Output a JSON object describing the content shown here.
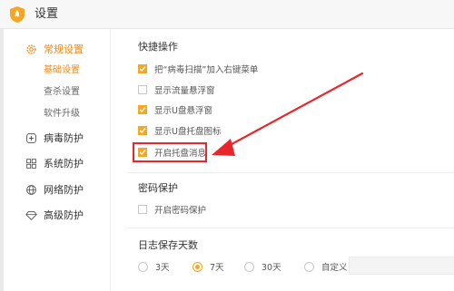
{
  "window": {
    "title": "设置"
  },
  "sidebar": {
    "groups": [
      {
        "label": "常规设置",
        "icon": "gear-icon",
        "active": true,
        "children": [
          {
            "label": "基础设置",
            "active": true
          },
          {
            "label": "查杀设置",
            "active": false
          },
          {
            "label": "软件升级",
            "active": false
          }
        ]
      },
      {
        "label": "病毒防护",
        "icon": "virus-protection-icon",
        "active": false
      },
      {
        "label": "系统防护",
        "icon": "system-protection-icon",
        "active": false
      },
      {
        "label": "网络防护",
        "icon": "globe-icon",
        "active": false
      },
      {
        "label": "高级防护",
        "icon": "diamond-icon",
        "active": false
      }
    ]
  },
  "main": {
    "quick_ops": {
      "title": "快捷操作",
      "options": [
        {
          "label": "把“病毒扫描”加入右键菜单",
          "checked": true
        },
        {
          "label": "显示流量悬浮窗",
          "checked": false
        },
        {
          "label": "显示U盘悬浮窗",
          "checked": true
        },
        {
          "label": "显示U盘托盘图标",
          "checked": true
        },
        {
          "label": "开启托盘消息",
          "checked": true
        }
      ]
    },
    "password": {
      "title": "密码保护",
      "options": [
        {
          "label": "开启密码保护",
          "checked": false
        }
      ]
    },
    "log_days": {
      "title": "日志保存天数",
      "options": [
        {
          "label": "3天",
          "selected": false
        },
        {
          "label": "7天",
          "selected": true
        },
        {
          "label": "30天",
          "selected": false
        },
        {
          "label": "自定义",
          "selected": false
        }
      ]
    }
  },
  "colors": {
    "accent": "#f5a623",
    "accent_text": "#f08a1c",
    "annotation": "#e8262b"
  }
}
